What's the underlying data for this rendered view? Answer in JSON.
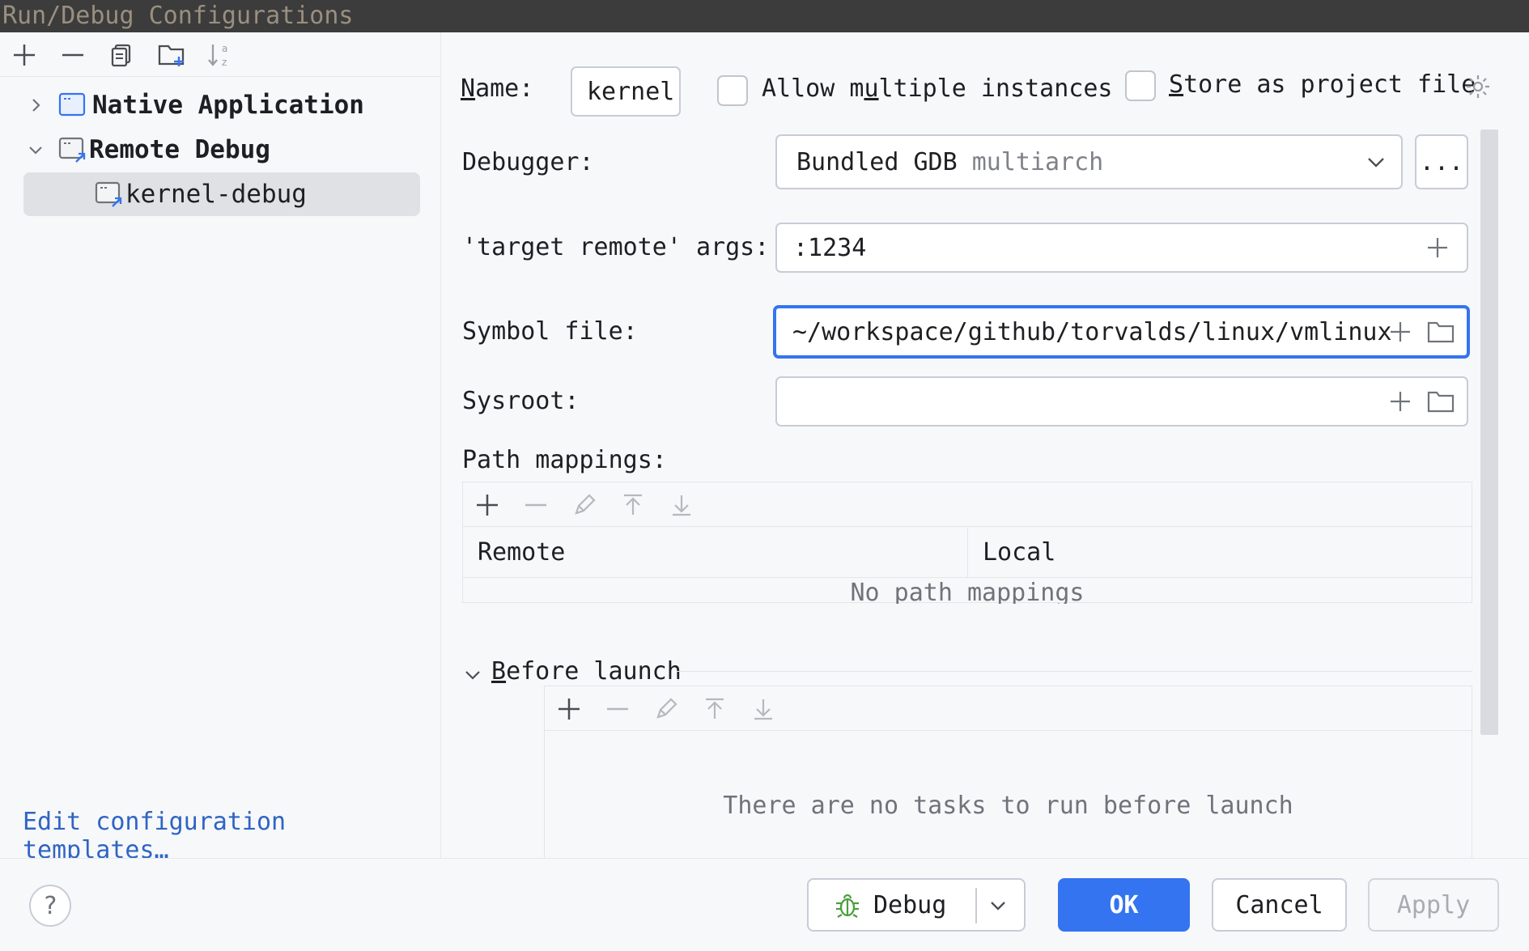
{
  "window": {
    "title": "Run/Debug Configurations"
  },
  "left_toolbar": {
    "icons": [
      "add-icon",
      "remove-icon",
      "copy-icon",
      "new-folder-icon",
      "sort-alpha-icon"
    ]
  },
  "tree": {
    "items": [
      {
        "label": "Native Application",
        "expanded": false,
        "bold": true
      },
      {
        "label": "Remote Debug",
        "expanded": true,
        "bold": true
      },
      {
        "label": "kernel-debug",
        "selected": true,
        "bold": false
      }
    ]
  },
  "edit_templates_link": "Edit configuration templates…",
  "form": {
    "name_label_rest": "ame:",
    "name_label_mnemonic": "N",
    "name_value": "kernel",
    "allow_multiple_pre": "Allow m",
    "allow_multiple_mnemonic": "u",
    "allow_multiple_post": "ltiple instances",
    "allow_multiple_checked": false,
    "store_mnemonic": "S",
    "store_rest": "tore as project file",
    "store_checked": false,
    "debugger_label": "Debugger:",
    "debugger_value": "Bundled GDB",
    "debugger_hint": "multiarch",
    "ellipsis_label": "...",
    "target_remote_label": "'target remote' args:",
    "target_remote_value": ":1234",
    "symbol_file_label": "Symbol file:",
    "symbol_file_value": "~/workspace/github/torvalds/linux/vmlinux",
    "sysroot_label": "Sysroot:",
    "sysroot_value": "",
    "path_mappings_label": "Path mappings:"
  },
  "path_mappings": {
    "columns": [
      "Remote",
      "Local"
    ],
    "empty_text": "No path mappings"
  },
  "before_launch": {
    "mnemonic": "B",
    "rest": "efore launch",
    "empty_text": "There are no tasks to run before launch"
  },
  "footer": {
    "help_label": "?",
    "debug_label": "Debug",
    "ok_label": "OK",
    "cancel_label": "Cancel",
    "apply_label": "Apply"
  },
  "colors": {
    "accent": "#3574f0",
    "link": "#2f64c4",
    "selection": "#dfe1e5",
    "bug_green": "#4c9e3f"
  }
}
